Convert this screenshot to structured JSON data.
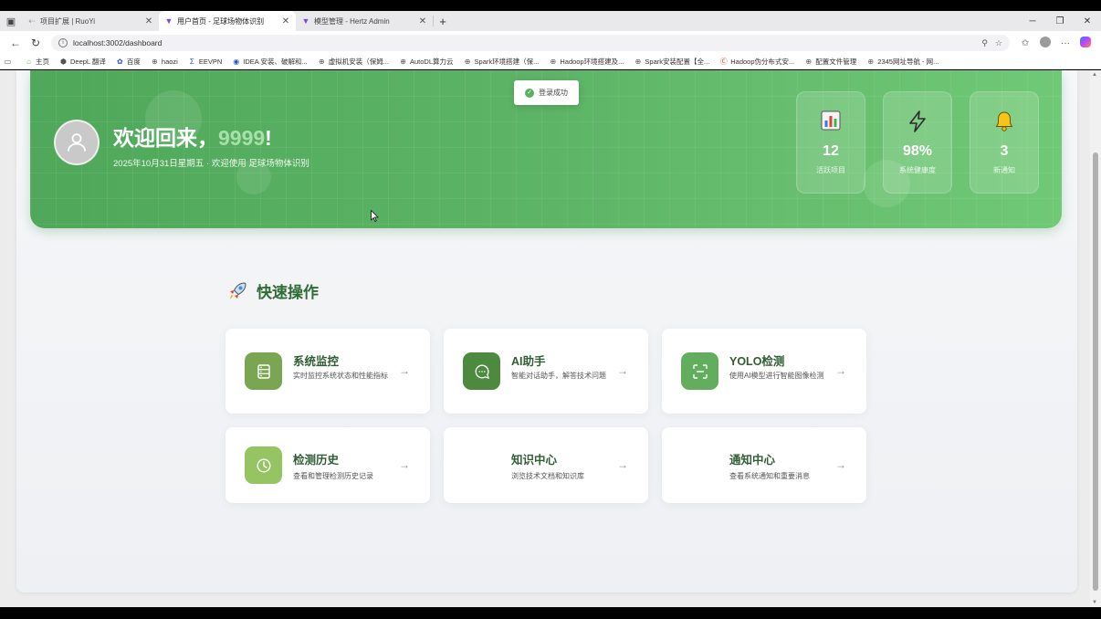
{
  "browser": {
    "tabs": [
      {
        "title": "项目扩展 | RuoYi",
        "active": false
      },
      {
        "title": "用户首页 - 足球场物体识别",
        "active": true
      },
      {
        "title": "模型管理 - Hertz Admin",
        "active": false
      }
    ],
    "url": "localhost:3002/dashboard",
    "bookmarks": [
      "主页",
      "DeepL 翻译",
      "百度",
      "haozi",
      "EEVPN",
      "IDEA 安装、破解和...",
      "虚拟机安装（保姆...",
      "AutoDL算力云",
      "Spark环境搭建（保...",
      "Hadoop环境搭建及...",
      "Spark安装配置【全...",
      "Hadoop伪分布式安...",
      "配置文件管理",
      "2345网址导航 - 网..."
    ]
  },
  "toast": {
    "text": "登录成功"
  },
  "banner": {
    "welcome_prefix": "欢迎回来，",
    "username": "9999",
    "welcome_suffix": "!",
    "subtitle": "2025年10月31日星期五 · 欢迎使用 足球场物体识别",
    "stats": [
      {
        "value": "12",
        "label": "活跃项目",
        "icon": "bar-chart-icon"
      },
      {
        "value": "98%",
        "label": "系统健康度",
        "icon": "lightning-icon"
      },
      {
        "value": "3",
        "label": "新通知",
        "icon": "bell-icon"
      }
    ]
  },
  "quick": {
    "title": "快速操作",
    "items": [
      {
        "title": "系统监控",
        "desc": "实时监控系统状态和性能指标",
        "color": "#7aa653",
        "icon": "server-icon"
      },
      {
        "title": "AI助手",
        "desc": "智能对话助手，解答技术问题",
        "color": "#4d8a3f",
        "icon": "chat-icon"
      },
      {
        "title": "YOLO检测",
        "desc": "使用AI模型进行智能图像检测",
        "color": "#62ad5e",
        "icon": "scan-icon"
      },
      {
        "title": "检测历史",
        "desc": "查看和管理检测历史记录",
        "color": "#97c463",
        "icon": "clock-icon"
      },
      {
        "title": "知识中心",
        "desc": "浏览技术文档和知识库",
        "color": "",
        "icon": ""
      },
      {
        "title": "通知中心",
        "desc": "查看系统通知和重要消息",
        "color": "",
        "icon": ""
      }
    ],
    "arrow": "→"
  }
}
